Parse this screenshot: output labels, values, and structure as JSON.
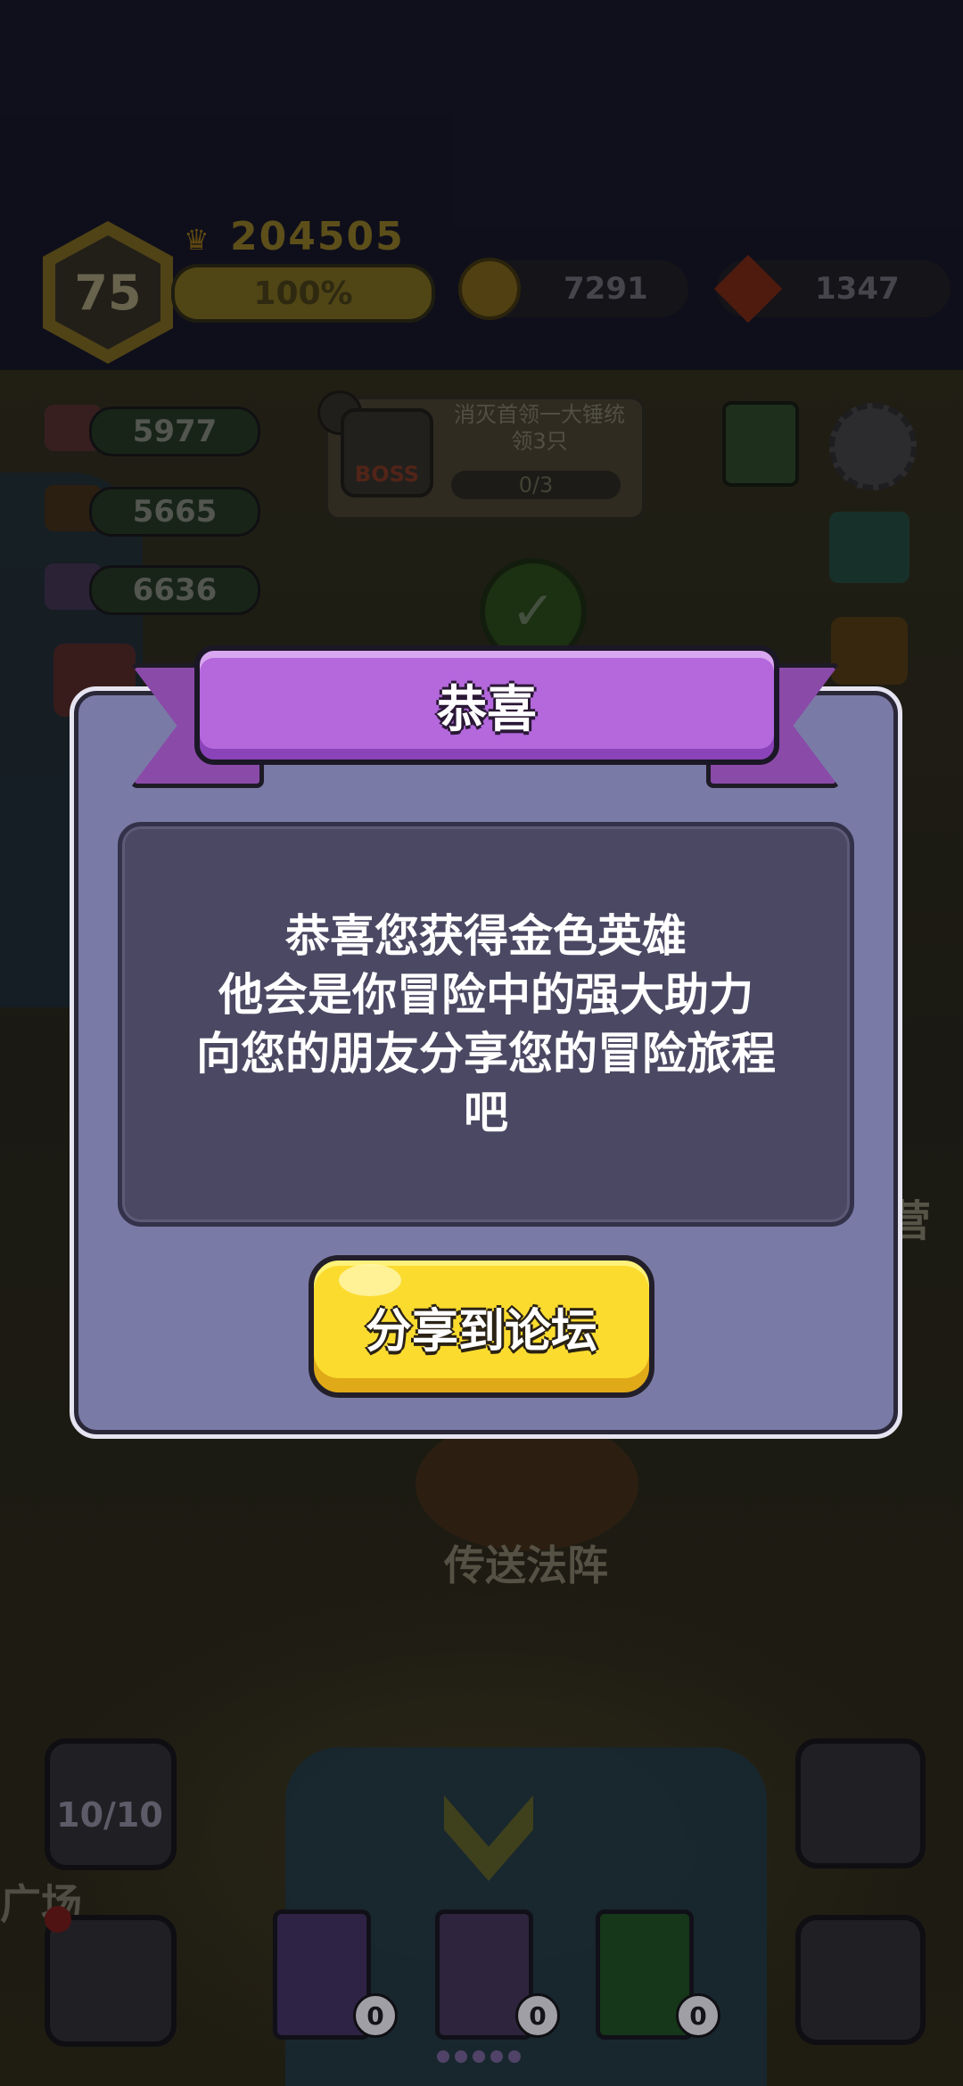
{
  "hud": {
    "level": "75",
    "score": "204505",
    "xp_percent_label": "100%",
    "gold": "7291",
    "gems": "1347"
  },
  "resources": {
    "meat": "5977",
    "wood": "5665",
    "ore": "6636"
  },
  "quest": {
    "badge": "BOSS",
    "text": "消灭首领一大锤统领3只",
    "progress": "0/3"
  },
  "map_labels": {
    "portal": "传送法阵",
    "camp": "营",
    "square": "广场"
  },
  "bottom": {
    "squad_count": "10/10",
    "book1_count": "0",
    "book2_count": "0",
    "book3_count": "0"
  },
  "dialog": {
    "title": "恭喜",
    "message_lines": [
      "恭喜您获得金色英雄",
      "他会是你冒险中的强大助力",
      "向您的朋友分享您的冒险旅程",
      "吧"
    ],
    "share_button": "分享到论坛"
  },
  "colors": {
    "ribbon": "#b468dc",
    "panel": "#7a7aa6",
    "message_box": "#4b4863",
    "button": "#fbdb2e"
  }
}
